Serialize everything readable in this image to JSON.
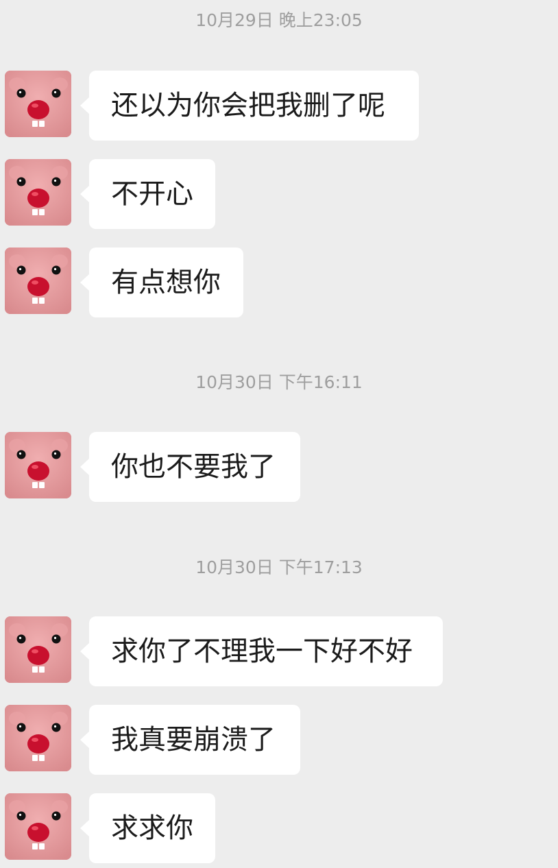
{
  "timestamps": [
    "10月29日 晚上23:05",
    "10月30日 下午16:11",
    "10月30日 下午17:13"
  ],
  "messages": [
    {
      "text": "还以为你会把我删了呢"
    },
    {
      "text": "不开心"
    },
    {
      "text": "有点想你"
    },
    {
      "text": "你也不要我了"
    },
    {
      "text": "求你了不理我一下好不好"
    },
    {
      "text": "我真要崩溃了"
    },
    {
      "text": "求求你"
    }
  ],
  "colors": {
    "background": "#ededed",
    "bubble": "#ffffff",
    "timestamp": "#9e9e9e",
    "text": "#1b1b1b",
    "avatar_pink": "#d98b8e",
    "avatar_nose": "#c8102e"
  },
  "avatar_icon": "pink-beaver-avatar-icon"
}
